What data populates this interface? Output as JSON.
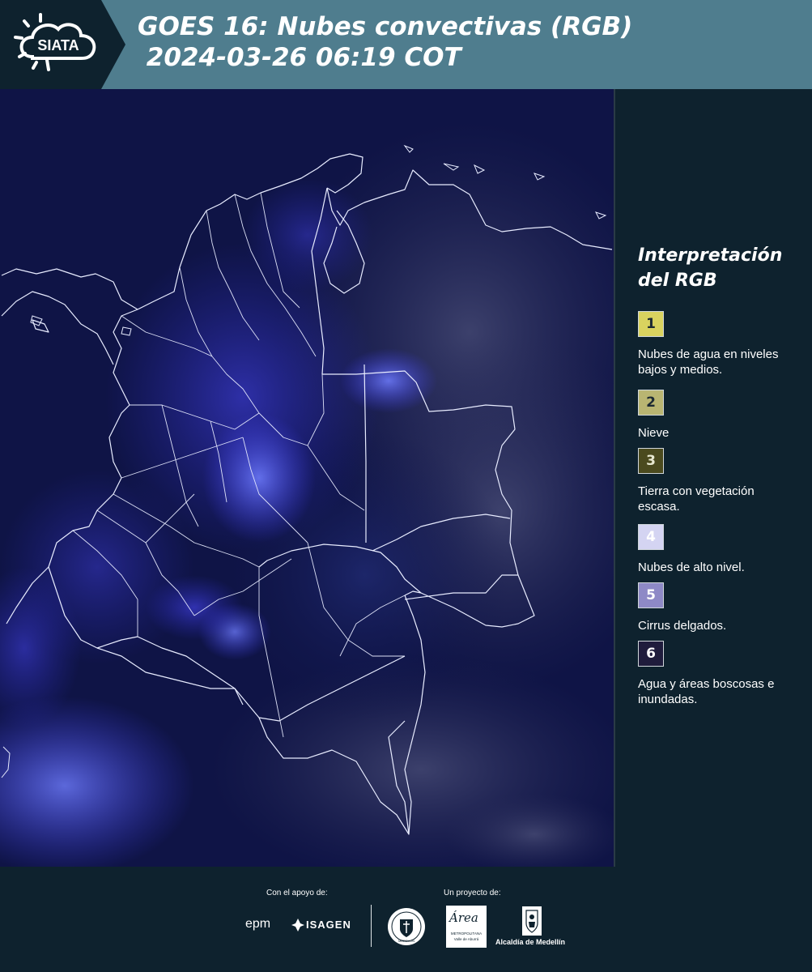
{
  "header": {
    "logo_text": "SIATA",
    "title_line1": "GOES 16: Nubes convectivas (RGB)",
    "title_line2": " 2024-03-26 06:19 COT"
  },
  "map": {
    "icon": "satellite-rgb-image-colombia"
  },
  "legend": {
    "title": "Interpretación del RGB",
    "items": [
      {
        "number": "1",
        "label": "Nubes de agua en niveles bajos y medios.",
        "color": "#d9d35f"
      },
      {
        "number": "2",
        "label": "Nieve",
        "color": "#b9b572"
      },
      {
        "number": "3",
        "label": "Tierra con vegetación escasa.",
        "color": "#4b4a1e"
      },
      {
        "number": "4",
        "label": "Nubes de alto nivel.",
        "color": "#d4d4f2"
      },
      {
        "number": "5",
        "label": "Cirrus delgados.",
        "color": "#8e89c6"
      },
      {
        "number": "6",
        "label": "Agua y áreas boscosas e inundadas.",
        "color": "#1f1c3c"
      }
    ]
  },
  "footer": {
    "support_label": "Con el apoyo de:",
    "project_label": "Un proyecto de:",
    "epm": "epm",
    "isagen": "ISAGEN",
    "area_brand": "Área",
    "area_sub1": "METROPOLITANA",
    "area_sub2": "Valle de Aburrá",
    "alcaldia": "Alcaldía de Medellín",
    "medellin_seal": "MEDELLÍN"
  }
}
